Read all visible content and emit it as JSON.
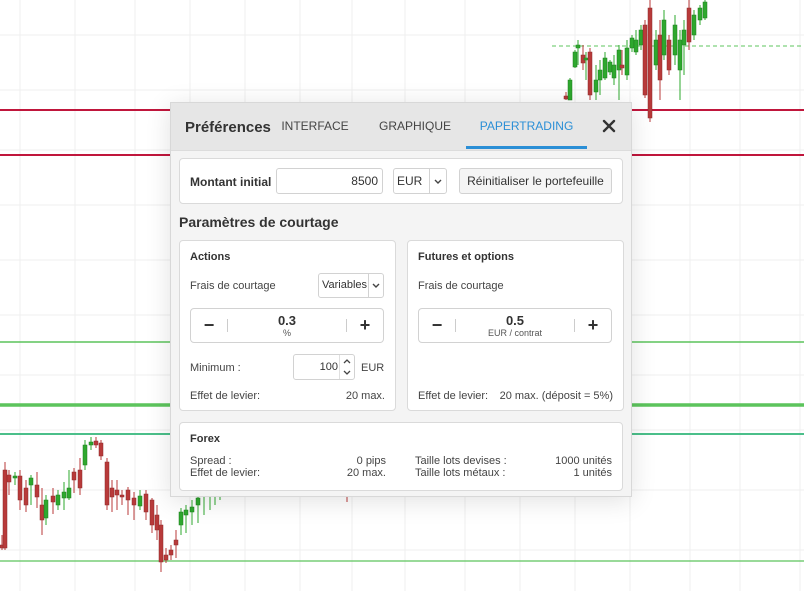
{
  "dialog": {
    "title": "Préférences",
    "tabs": [
      {
        "label": "INTERFACE",
        "active": false
      },
      {
        "label": "GRAPHIQUE",
        "active": false
      },
      {
        "label": "PAPERTRADING",
        "active": true
      }
    ],
    "close_icon": "close-icon",
    "accent_color": "#2b8fd6"
  },
  "initial": {
    "label": "Montant initial",
    "amount": "8500",
    "currency": "EUR",
    "reset_label": "Réinitialiser le portefeuille"
  },
  "brokerage": {
    "title": "Paramètres de courtage",
    "actions": {
      "title": "Actions",
      "fees_label": "Frais de courtage",
      "fees_mode": "Variables",
      "fee_value": "0.3",
      "fee_unit": "%",
      "minimum_label": "Minimum :",
      "minimum_value": "100",
      "minimum_currency": "EUR",
      "leverage_label": "Effet de levier:",
      "leverage_value": "20 max."
    },
    "futures": {
      "title": "Futures et options",
      "fees_label": "Frais de courtage",
      "fee_value": "0.5",
      "fee_unit": "EUR / contrat",
      "leverage_label": "Effet de levier:",
      "leverage_value": "20 max. (déposit = 5%)"
    },
    "forex": {
      "title": "Forex",
      "spread_label": "Spread :",
      "spread_value": "0 pips",
      "leverage_label": "Effet de levier:",
      "leverage_value": "20 max.",
      "lot_currency_label": "Taille lots devises :",
      "lot_currency_value": "1000 unités",
      "lot_metal_label": "Taille lots métaux :",
      "lot_metal_value": "1 unités"
    }
  },
  "chart": {
    "up_color": "#2ea82e",
    "down_color": "#b83a3a",
    "resistance_color": "#c0163c",
    "support_color": "#5cc45c",
    "teal_color": "#4bbf8a"
  }
}
